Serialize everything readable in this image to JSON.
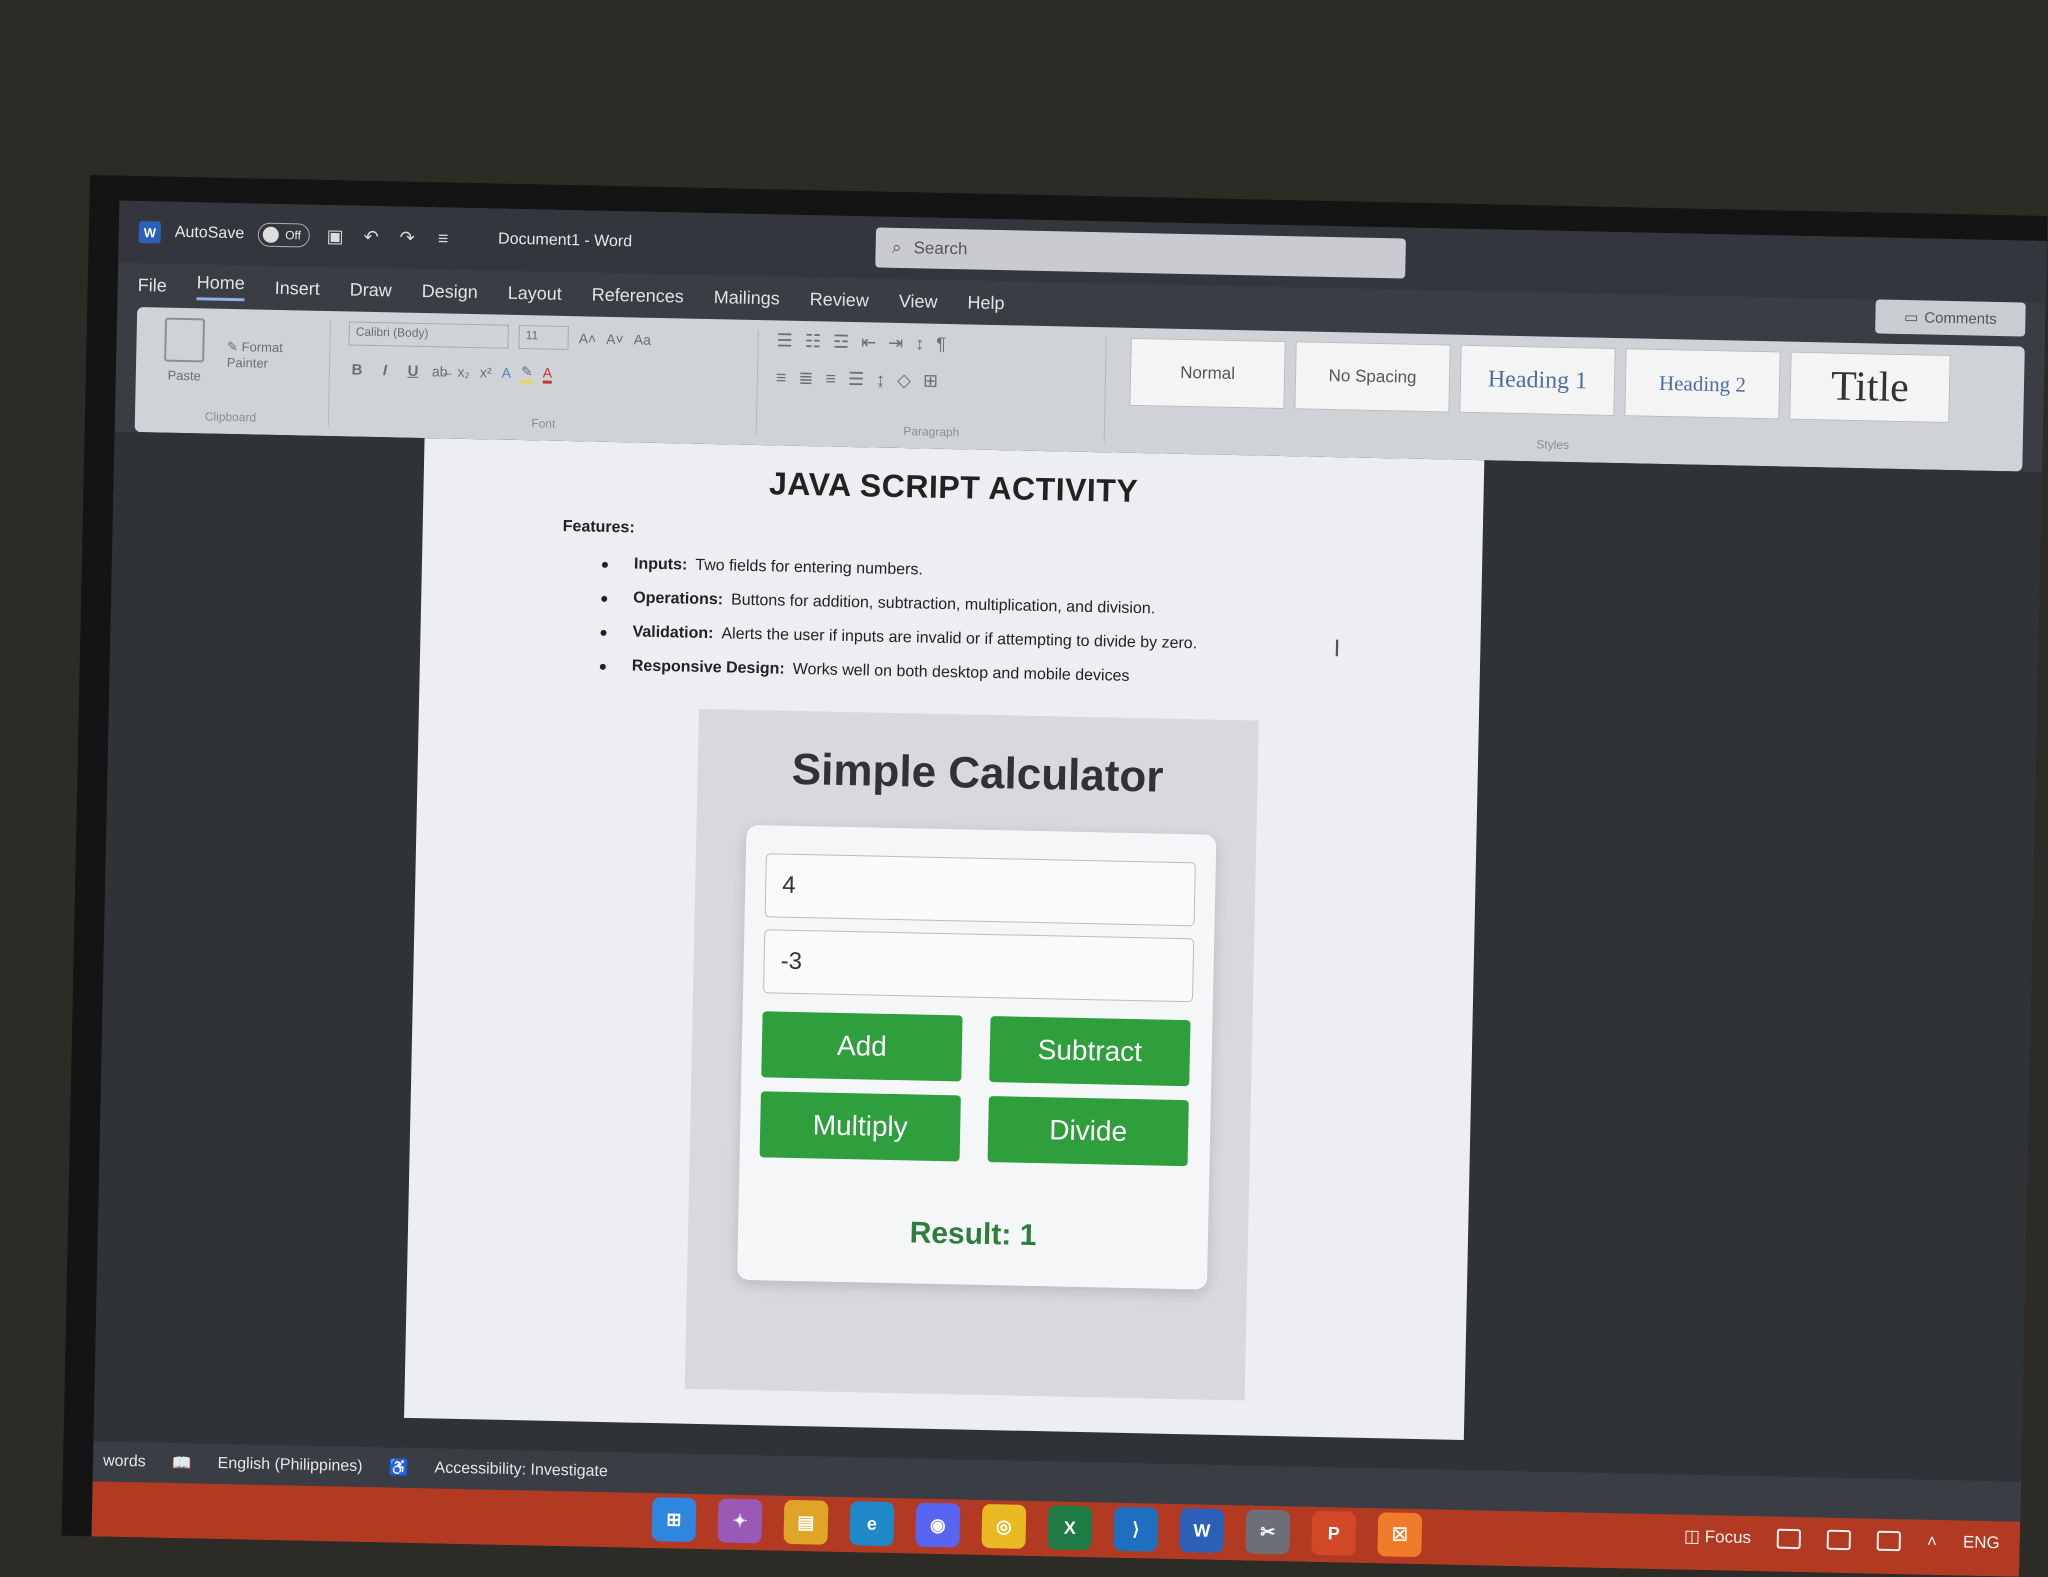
{
  "titlebar": {
    "autosave_label": "AutoSave",
    "autosave_state": "Off",
    "doc_title": "Document1 - Word",
    "search_placeholder": "Search"
  },
  "tabs": [
    "File",
    "Home",
    "Insert",
    "Draw",
    "Design",
    "Layout",
    "References",
    "Mailings",
    "Review",
    "View",
    "Help"
  ],
  "active_tab": "Home",
  "comments_label": "Comments",
  "ribbon": {
    "clipboard": {
      "paste": "Paste",
      "format_painter": "Format Painter",
      "label": "Clipboard"
    },
    "font": {
      "name": "Calibri (Body)",
      "size": "11",
      "label": "Font",
      "bold": "B",
      "italic": "I",
      "underline": "U"
    },
    "paragraph": {
      "label": "Paragraph"
    },
    "styles": {
      "label": "Styles",
      "items": [
        "Normal",
        "No Spacing",
        "Heading 1",
        "Heading 2",
        "Title"
      ]
    }
  },
  "document": {
    "heading": "JAVA SCRIPT ACTIVITY",
    "features_label": "Features:",
    "features": [
      {
        "term": "Inputs:",
        "text": "Two fields for entering numbers."
      },
      {
        "term": "Operations:",
        "text": "Buttons for addition, subtraction, multiplication, and division."
      },
      {
        "term": "Validation:",
        "text": "Alerts the user if inputs are invalid or if attempting to divide by zero."
      },
      {
        "term": "Responsive Design:",
        "text": "Works well on both desktop and mobile devices"
      }
    ],
    "calculator": {
      "title": "Simple Calculator",
      "input1": "4",
      "input2": "-3",
      "buttons": {
        "add": "Add",
        "subtract": "Subtract",
        "multiply": "Multiply",
        "divide": "Divide"
      },
      "result": "Result: 1"
    }
  },
  "statusbar": {
    "words": "words",
    "language": "English (Philippines)",
    "accessibility": "Accessibility: Investigate",
    "focus": "Focus"
  },
  "taskbar": {
    "tray_lang": "ENG"
  },
  "colors": {
    "calc_button": "#2f9e3c",
    "result_text": "#2f7d3a",
    "taskbar": "#b33a22"
  }
}
